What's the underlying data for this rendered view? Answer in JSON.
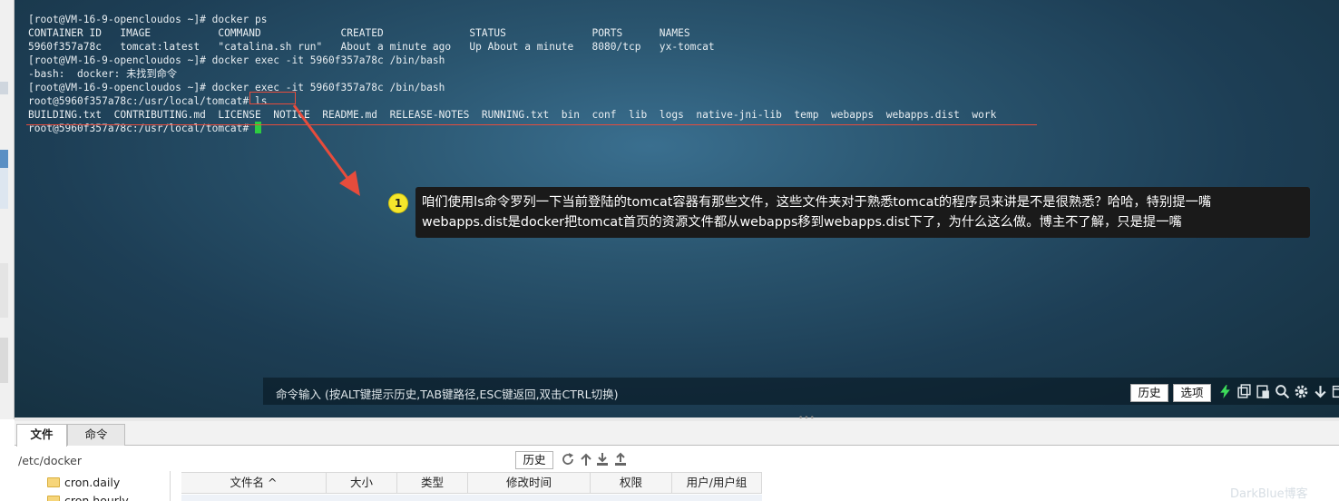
{
  "terminal": {
    "lines": [
      "[root@VM-16-9-opencloudos ~]# docker ps",
      "CONTAINER ID   IMAGE           COMMAND             CREATED              STATUS              PORTS      NAMES",
      "5960f357a78c   tomcat:latest   \"catalina.sh run\"   About a minute ago   Up About a minute   8080/tcp   yx-tomcat",
      "[root@VM-16-9-opencloudos ~]# docker exec -it 5960f357a78c /bin/bash",
      "-bash:  docker: 未找到命令",
      "[root@VM-16-9-opencloudos ~]# docker exec -it 5960f357a78c /bin/bash",
      "root@5960f357a78c:/usr/local/tomcat# ls",
      "BUILDING.txt  CONTRIBUTING.md  LICENSE  NOTICE  README.md  RELEASE-NOTES  RUNNING.txt  bin  conf  lib  logs  native-jni-lib  temp  webapps  webapps.dist  work"
    ],
    "prompt": "root@5960f357a78c:/usr/local/tomcat# "
  },
  "annotation": {
    "badge": "1",
    "line1": "咱们使用ls命令罗列一下当前登陆的tomcat容器有那些文件，这些文件夹对于熟悉tomcat的程序员来讲是不是很熟悉？哈哈，特别提一嘴",
    "line2": "webapps.dist是docker把tomcat首页的资源文件都从webapps移到webapps.dist下了，为什么这么做。博主不了解，只是提一嘴"
  },
  "command_bar": {
    "hint": "命令输入 (按ALT键提示历史,TAB键路径,ESC键返回,双击CTRL切换)",
    "history_label": "历史",
    "options_label": "选项",
    "icons": [
      "lightning-icon",
      "copy-icon",
      "paste-icon",
      "search-icon",
      "gear-icon",
      "download-icon",
      "window-icon"
    ]
  },
  "bottom_panel": {
    "tabs": [
      {
        "label": "文件",
        "active": true
      },
      {
        "label": "命令",
        "active": false
      }
    ],
    "path": "/etc/docker",
    "history_label": "历史",
    "tree": [
      {
        "label": "cron.daily"
      },
      {
        "label": "cron.hourly"
      }
    ],
    "columns": [
      "文件名 ^",
      "大小",
      "类型",
      "修改时间",
      "权限",
      "用户/用户组"
    ]
  },
  "watermark": "DarkBlue博客",
  "colors": {
    "terminal_bg": "#2a556f",
    "terminal_text": "#e8eef2",
    "highlight_red": "#e74c3c",
    "cursor_green": "#2ecc40",
    "badge_yellow": "#f5e62c",
    "annotation_bg": "#1a1a1a"
  }
}
